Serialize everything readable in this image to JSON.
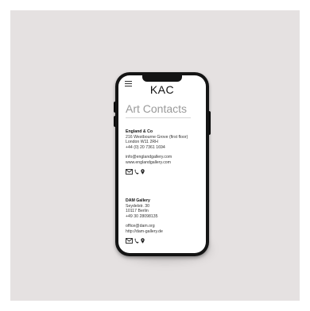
{
  "app": {
    "title": "KAC"
  },
  "page": {
    "title": "Art Contacts"
  },
  "contacts": [
    {
      "name": "England & Co",
      "address": [
        "216 Westbourne Grove (first floor)",
        "London W11 2RH"
      ],
      "phone": "+44 (0) 20 7361 1694",
      "email": "info@englandgallery.com",
      "website": "www.englandgallery.com",
      "icons": [
        "mail-icon",
        "phone-icon",
        "map-pin-icon"
      ]
    },
    {
      "name": "DAM Gallery",
      "address": [
        "Seydelstr. 30",
        "10117 Berlin"
      ],
      "phone": "+49 30 28098135",
      "email": "office@dam.org",
      "website": "http://dam-gallery.de",
      "icons": [
        "mail-icon",
        "phone-icon",
        "map-pin-icon"
      ]
    }
  ],
  "colors": {
    "background": "#e5e1e1",
    "phone_body": "#141414",
    "screen": "#ffffff",
    "title_grey": "#9a9a9a"
  }
}
